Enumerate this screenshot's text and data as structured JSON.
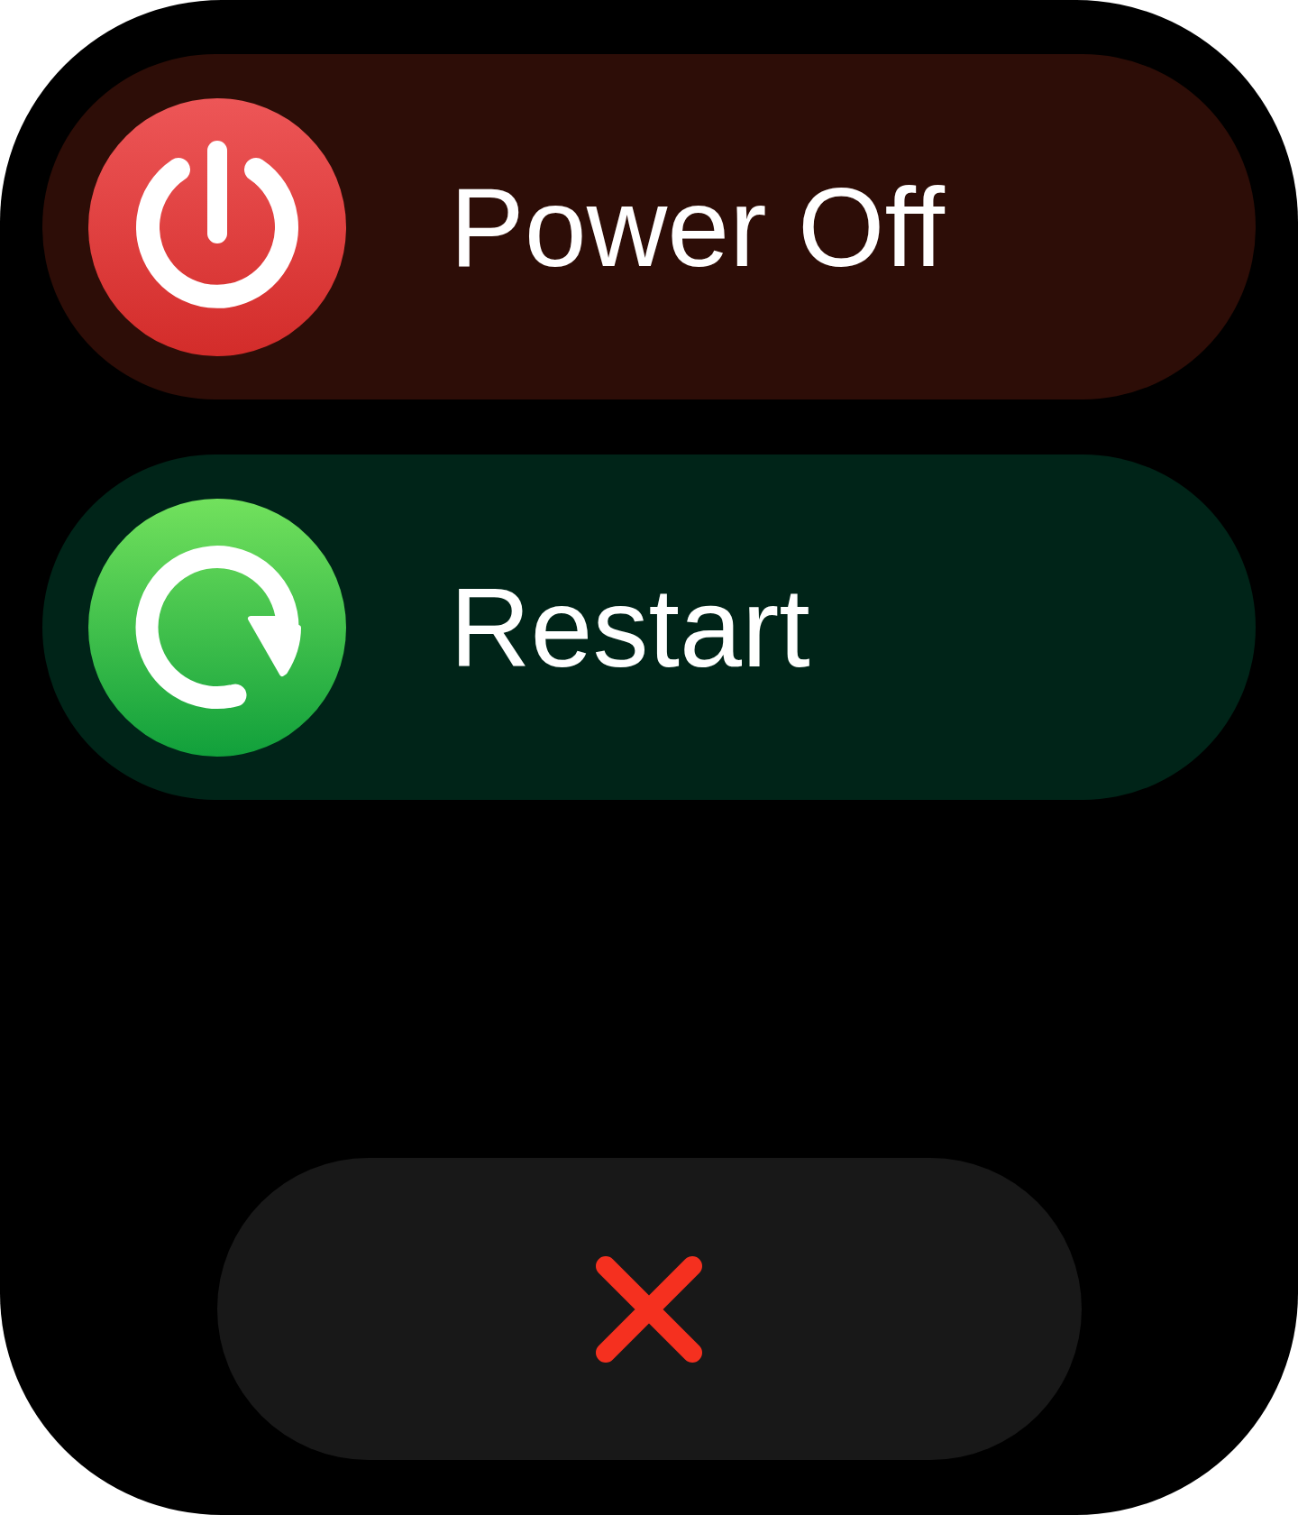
{
  "actions": [
    {
      "kind": "power",
      "label": "Power Off"
    },
    {
      "kind": "restart",
      "label": "Restart"
    }
  ]
}
